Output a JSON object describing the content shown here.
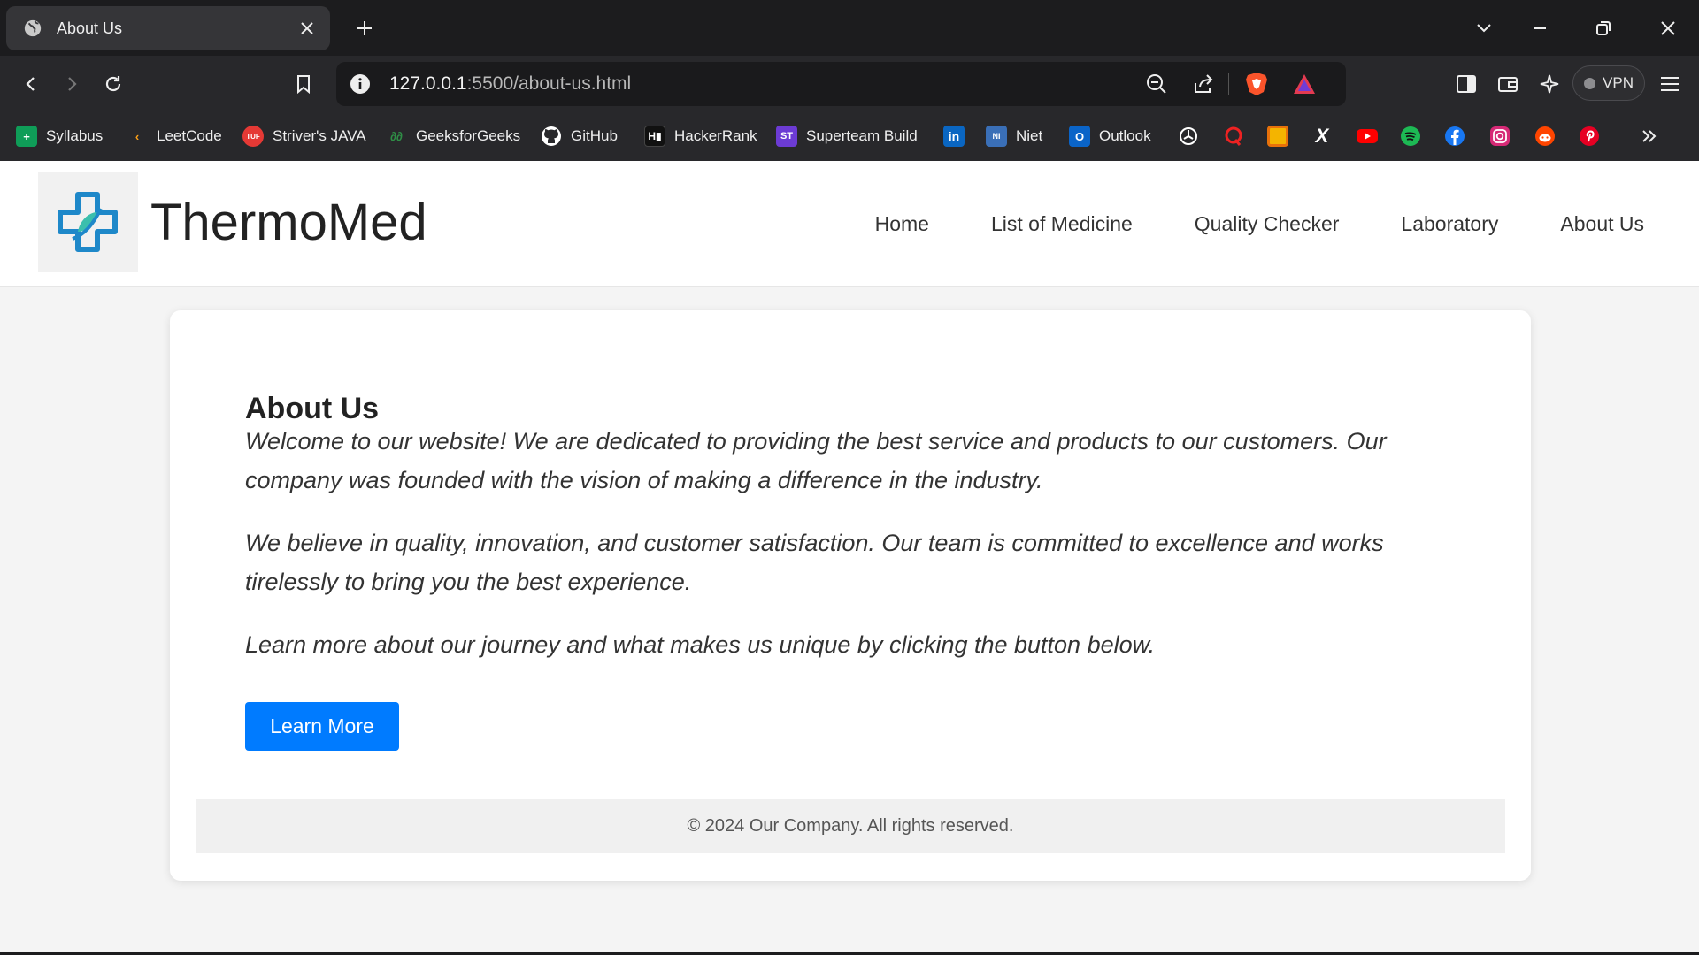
{
  "browser": {
    "tab": {
      "title": "About Us"
    },
    "url": {
      "host": "127.0.0.1",
      "rest": ":5500/about-us.html"
    },
    "vpn_label": "VPN",
    "bookmarks": [
      {
        "label": "Syllabus",
        "icon": "sheets-icon",
        "color": "#0f9d58"
      },
      {
        "label": "LeetCode",
        "icon": "leetcode-icon",
        "color": "#ffa116"
      },
      {
        "label": "Striver's JAVA",
        "icon": "tuf-icon",
        "color": "#e53935"
      },
      {
        "label": "GeeksforGeeks",
        "icon": "gfg-icon",
        "color": "#2f8d46"
      },
      {
        "label": "GitHub",
        "icon": "github-icon",
        "color": "#ffffff"
      },
      {
        "label": "HackerRank",
        "icon": "hackerrank-icon",
        "color": "#1ba94c"
      },
      {
        "label": "Superteam Build",
        "icon": "superteam-icon",
        "color": "#6c3bd4"
      },
      {
        "label": "Niet",
        "icon": "niet-icon",
        "color": "#3a6fb7"
      },
      {
        "label": "Outlook",
        "icon": "outlook-icon",
        "color": "#0a64c8"
      }
    ]
  },
  "site": {
    "brand": "ThermoMed",
    "nav": [
      "Home",
      "List of Medicine",
      "Quality Checker",
      "Laboratory",
      "About Us"
    ]
  },
  "content": {
    "heading": "About Us",
    "paragraphs": [
      "Welcome to our website! We are dedicated to providing the best service and products to our customers. Our company was founded with the vision of making a difference in the industry.",
      "We believe in quality, innovation, and customer satisfaction. Our team is committed to excellence and works tirelessly to bring you the best experience.",
      "Learn more about our journey and what makes us unique by clicking the button below."
    ],
    "button": "Learn More",
    "footer": "© 2024 Our Company. All rights reserved."
  },
  "colors": {
    "primary": "#007bff",
    "logo_blue": "#1e88c9",
    "logo_teal": "#3bbfad"
  }
}
